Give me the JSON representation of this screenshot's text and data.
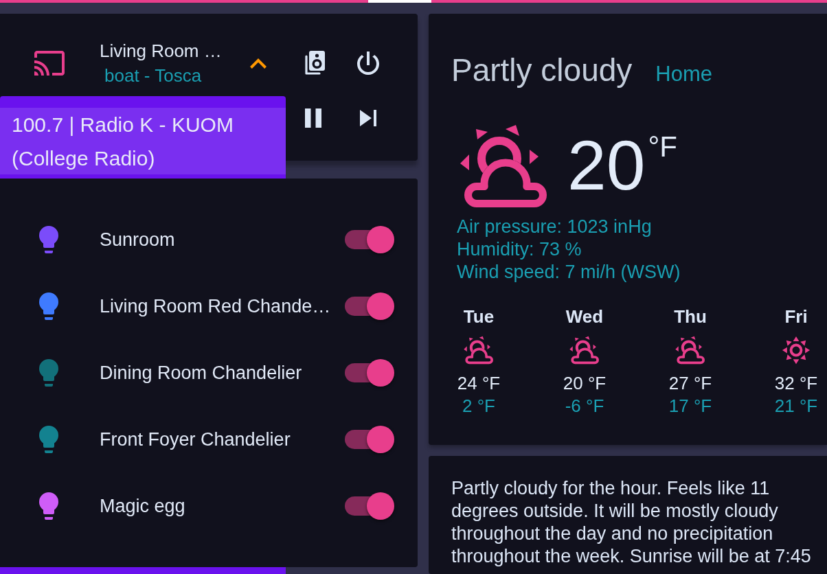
{
  "media_player": {
    "title": "Living Room …",
    "subtitle": "boat - Tosca",
    "expanded": true,
    "playing": true
  },
  "source_menu": {
    "items": [
      {
        "label": "100.7 | Radio K - KUOM (College Radio)",
        "selected": true
      }
    ]
  },
  "lights": [
    {
      "name": "Sunroom",
      "color": "#7b4cfa",
      "on": true
    },
    {
      "name": "Living Room Red Chande…",
      "color": "#3f7bff",
      "on": true
    },
    {
      "name": "Dining Room Chandelier",
      "color": "#12707a",
      "on": true
    },
    {
      "name": "Front Foyer Chandelier",
      "color": "#138290",
      "on": true
    },
    {
      "name": "Magic egg",
      "color": "#cf5df8",
      "on": true
    }
  ],
  "weather": {
    "condition": "Partly cloudy",
    "location": "Home",
    "kind": "partly-cloudy",
    "temperature": "20",
    "unit": "°F",
    "attributes": [
      "Air pressure: 1023 inHg",
      "Humidity: 73 %",
      "Wind speed: 7 mi/h (WSW)"
    ],
    "forecast": [
      {
        "day": "Tue",
        "kind": "partly-cloudy",
        "high": "24 °F",
        "low": "2 °F"
      },
      {
        "day": "Wed",
        "kind": "partly-cloudy",
        "high": "20 °F",
        "low": "-6 °F"
      },
      {
        "day": "Thu",
        "kind": "partly-cloudy",
        "high": "27 °F",
        "low": "17 °F"
      },
      {
        "day": "Fri",
        "kind": "sunny",
        "high": "32 °F",
        "low": "21 °F"
      }
    ]
  },
  "summary": {
    "text": "Partly cloudy for the hour. Feels like 11 degrees outside. It will be mostly cloudy throughout the day and no precipitation throughout the week. Sunrise will be at 7:45"
  }
}
